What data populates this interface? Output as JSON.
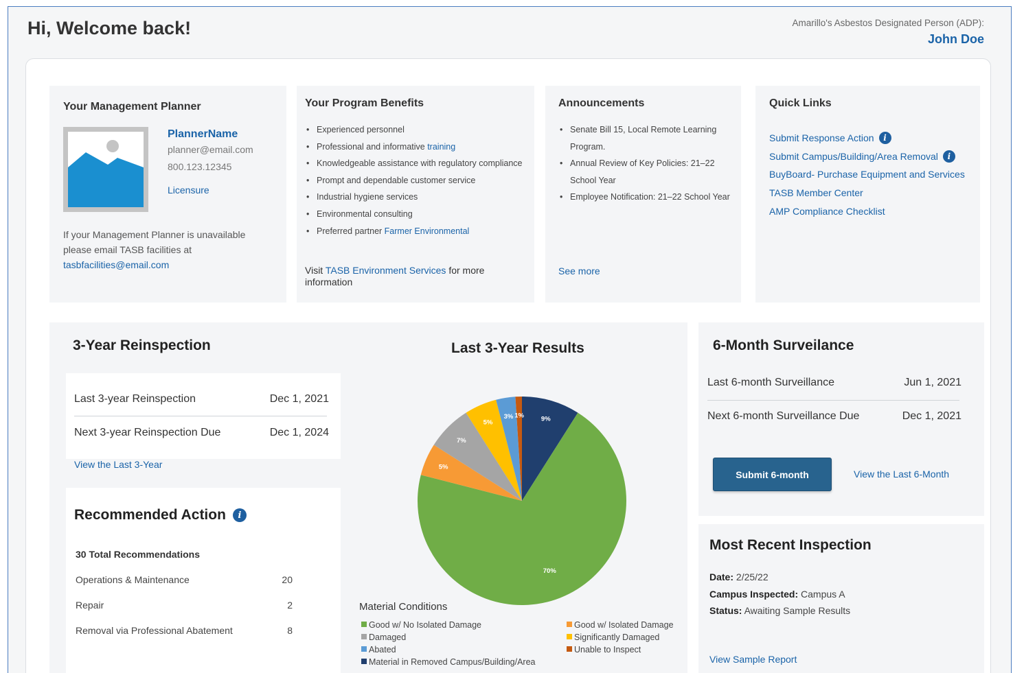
{
  "header": {
    "welcome": "Hi, Welcome back!",
    "adp_label": "Amarillo's Asbestos Designated Person (ADP):",
    "adp_name": "John Doe"
  },
  "planner": {
    "title": "Your Management Planner",
    "name": "PlannerName",
    "email": "planner@email.com",
    "phone": "800.123.12345",
    "licensure": "Licensure",
    "note": "If your Management Planner is unavailable please email TASB facilities at",
    "note_email": "tasbfacilities@email.com"
  },
  "benefits": {
    "title": "Your Program Benefits",
    "items": [
      {
        "text": "Experienced personnel",
        "link": ""
      },
      {
        "text": "Professional and informative ",
        "link": "training"
      },
      {
        "text": "Knowledgeable assistance with regulatory compliance",
        "link": ""
      },
      {
        "text": "Prompt and dependable customer service",
        "link": ""
      },
      {
        "text": "Industrial hygiene services",
        "link": ""
      },
      {
        "text": "Environmental consulting",
        "link": ""
      },
      {
        "text": "Preferred partner ",
        "link": "Farmer Environmental"
      }
    ],
    "visit_prefix": "Visit ",
    "visit_link": "TASB Environment Services",
    "visit_suffix": " for more information"
  },
  "announcements": {
    "title": "Announcements",
    "items": [
      "Senate Bill 15, Local Remote Learning Program.",
      "Annual Review of Key Policies: 21–22 School Year",
      "Employee Notification: 21–22 School Year"
    ],
    "see_more": "See more"
  },
  "quick_links": {
    "title": "Quick Links",
    "items": [
      {
        "label": "Submit Response Action",
        "info": true
      },
      {
        "label": "Submit Campus/Building/Area Removal",
        "info": true
      },
      {
        "label": "BuyBoard- Purchase Equipment and Services",
        "info": false
      },
      {
        "label": "TASB Member Center",
        "info": false
      },
      {
        "label": "AMP Compliance Checklist",
        "info": false
      }
    ]
  },
  "reinspection": {
    "title": "3-Year Reinspection",
    "rows": [
      {
        "label": "Last 3-year Reinspection",
        "value": "Dec 1, 2021"
      },
      {
        "label": "Next 3-year Reinspection Due",
        "value": "Dec 1, 2024"
      }
    ],
    "view_link": "View the Last 3-Year"
  },
  "recommended": {
    "title": "Recommended Action",
    "total": "30 Total Recommendations",
    "rows": [
      {
        "label": "Operations & Maintenance",
        "value": "20"
      },
      {
        "label": "Repair",
        "value": "2"
      },
      {
        "label": "Removal via Professional Abatement",
        "value": "8"
      }
    ]
  },
  "chart_data": {
    "type": "pie",
    "title": "Last 3-Year Results",
    "legend_title": "Material Conditions",
    "slices": [
      {
        "name": "Material in Removed Campus/Building/Area",
        "value": 9,
        "label": "9%",
        "color": "#203f6e"
      },
      {
        "name": "Good w/ No Isolated Damage",
        "value": 70,
        "label": "70%",
        "color": "#70ad47"
      },
      {
        "name": "Good w/ Isolated Damage",
        "value": 5,
        "label": "5%",
        "color": "#f79a35"
      },
      {
        "name": "Damaged",
        "value": 7,
        "label": "7%",
        "color": "#a5a5a5"
      },
      {
        "name": "Significantly Damaged",
        "value": 5,
        "label": "5%",
        "color": "#ffc000"
      },
      {
        "name": "Abated",
        "value": 3,
        "label": "3%",
        "color": "#5b9bd5"
      },
      {
        "name": "Unable to Inspect",
        "value": 1,
        "label": "1%",
        "color": "#c55a11"
      }
    ],
    "legend_order": [
      "Good w/ No Isolated Damage",
      "Good w/ Isolated Damage",
      "Damaged",
      "Significantly Damaged",
      "Abated",
      "Unable to Inspect",
      "Material in Removed Campus/Building/Area"
    ]
  },
  "surveillance": {
    "title": "6-Month Surveilance",
    "rows": [
      {
        "label": "Last 6-month Surveillance",
        "value": "Jun 1, 2021"
      },
      {
        "label": "Next 6-month Surveillance Due",
        "value": "Dec 1, 2021"
      }
    ],
    "submit_label": "Submit 6-month",
    "view_link": "View the Last 6-Month"
  },
  "recent_inspection": {
    "title": "Most Recent Inspection",
    "date_label": "Date:",
    "date": " 2/25/22",
    "campus_label": "Campus Inspected:",
    "campus": " Campus A",
    "status_label": "Status:",
    "status": " Awaiting Sample Results",
    "view_link": "View Sample Report"
  },
  "colors": {
    "link": "#1a63a8",
    "button": "#28638e",
    "panel": "#f4f5f7"
  }
}
